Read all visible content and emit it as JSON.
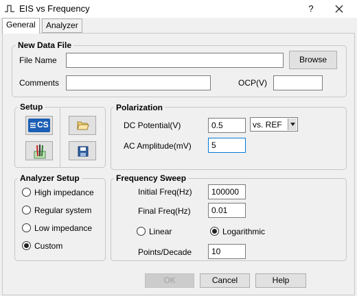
{
  "window": {
    "title": "EIS vs Frequency",
    "help_label": "?",
    "close_label": "✕"
  },
  "tabs": [
    {
      "label": "General",
      "active": true
    },
    {
      "label": "Analyzer",
      "active": false
    }
  ],
  "new_data_file": {
    "group_label": "New Data File",
    "file_name_label": "File Name",
    "file_name_value": "",
    "browse_label": "Browse",
    "comments_label": "Comments",
    "comments_value": "",
    "ocp_label": "OCP(V)",
    "ocp_value": ""
  },
  "setup": {
    "group_label": "Setup",
    "buttons": [
      {
        "icon": "cs-icon",
        "text": "CS"
      },
      {
        "icon": "folder-open-icon"
      },
      {
        "icon": "electrodes-icon"
      },
      {
        "icon": "save-icon"
      }
    ]
  },
  "polarization": {
    "group_label": "Polarization",
    "dc_label": "DC Potential(V)",
    "dc_value": "0.5",
    "ref_value": "vs. REF",
    "ac_label": "AC Amplitude(mV)",
    "ac_value": "5"
  },
  "analyzer_setup": {
    "group_label": "Analyzer Setup",
    "options": [
      {
        "label": "High impedance",
        "selected": false
      },
      {
        "label": "Regular system",
        "selected": false
      },
      {
        "label": "Low impedance",
        "selected": false
      },
      {
        "label": "Custom",
        "selected": true
      }
    ]
  },
  "frequency_sweep": {
    "group_label": "Frequency Sweep",
    "initial_label": "Initial Freq(Hz)",
    "initial_value": "100000",
    "final_label": "Final Freq(Hz)",
    "final_value": "0.01",
    "linear_label": "Linear",
    "linear_selected": false,
    "log_label": "Logarithmic",
    "log_selected": true,
    "points_label": "Points/Decade",
    "points_value": "10"
  },
  "footer": {
    "ok_label": "OK",
    "cancel_label": "Cancel",
    "help_label": "Help"
  },
  "colors": {
    "focus_border": "#0078d7",
    "cs_blue": "#1c5fb5"
  }
}
